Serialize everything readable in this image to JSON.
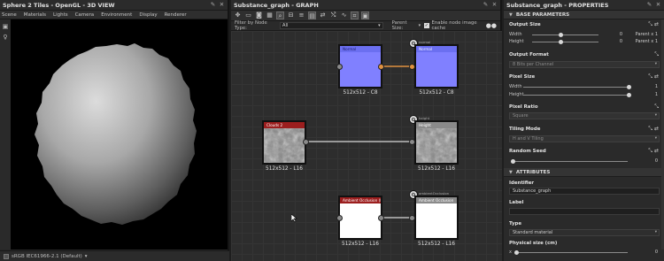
{
  "view3d": {
    "title": "Sphere 2 Tiles - OpenGL - 3D VIEW",
    "menu": [
      "Scene",
      "Materials",
      "Lights",
      "Camera",
      "Environment",
      "Display",
      "Renderer"
    ],
    "colorspace": "sRGB IEC61966-2.1 (Default)"
  },
  "graph": {
    "title": "Substance_graph - GRAPH",
    "filter_label": "Filter by Node Type:",
    "filter_value": "All",
    "parent_size_label": "Parent Size:",
    "cache_label": "Enable node image cache",
    "nodes": {
      "normal_in": {
        "header": "Normal",
        "caption": "512x512 - C8"
      },
      "normal_out": {
        "header": "Normal",
        "caption": "512x512 - C8",
        "port_label": "normal"
      },
      "clouds": {
        "header": "Clouds 2",
        "caption": "512x512 - L16"
      },
      "height_out": {
        "header": "Height",
        "caption": "512x512 - L16",
        "port_label": "height"
      },
      "ao_in": {
        "header": "Ambient Occlusion (HB...",
        "caption": "512x512 - L16"
      },
      "ao_out": {
        "header": "Ambient Occlusion",
        "caption": "512x512 - L16",
        "port_label": "ambientOcclusion"
      }
    }
  },
  "properties": {
    "title": "Substance_graph - PROPERTIES",
    "base_section": "BASE PARAMETERS",
    "output_size": {
      "label": "Output Size",
      "width_label": "Width",
      "width_value": "0",
      "width_parent": "Parent x 1",
      "height_label": "Height",
      "height_value": "0",
      "height_parent": "Parent x 1"
    },
    "output_format": {
      "label": "Output Format",
      "value": "8 Bits per Channel"
    },
    "pixel_size": {
      "label": "Pixel Size",
      "width_label": "Width",
      "width_value": "1",
      "height_label": "Height",
      "height_value": "1"
    },
    "pixel_ratio": {
      "label": "Pixel Ratio",
      "value": "Square"
    },
    "tiling_mode": {
      "label": "Tiling Mode",
      "value": "H and V Tiling"
    },
    "random_seed": {
      "label": "Random Seed",
      "value": "0"
    },
    "attributes_section": "ATTRIBUTES",
    "identifier": {
      "label": "Identifier",
      "value": "Substance_graph"
    },
    "label_field": {
      "label": "Label",
      "value": ""
    },
    "type": {
      "label": "Type",
      "value": "Standard material"
    },
    "physical_size": {
      "label": "Physical size (cm)",
      "x_label": "x",
      "x_value": "0"
    }
  }
}
